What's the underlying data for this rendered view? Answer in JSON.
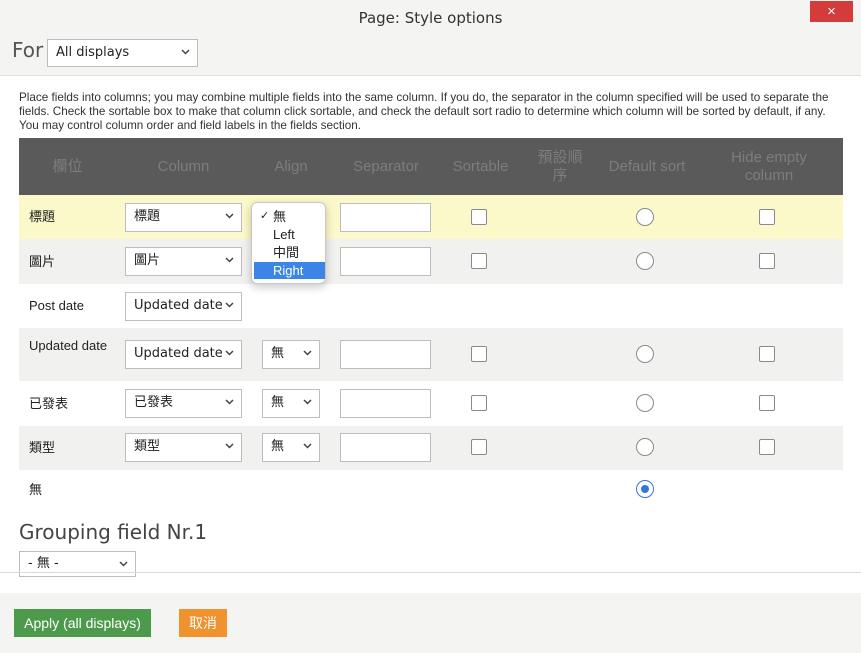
{
  "dialog": {
    "title": "Page: Style options",
    "close_icon": "×"
  },
  "for": {
    "label": "For",
    "selected": "All displays"
  },
  "description": "Place fields into columns; you may combine multiple fields into the same column. If you do, the separator in the column specified will be used to separate the fields. Check the sortable box to make that column click sortable, and check the default sort radio to determine which column will be sorted by default, if any. You may control column order and field labels in the fields section.",
  "table": {
    "headers": [
      "欄位",
      "Column",
      "Align",
      "Separator",
      "Sortable",
      "預設順序",
      "Default sort",
      "Hide empty column"
    ],
    "rows": [
      {
        "field": "標題",
        "column": "標題",
        "align": "無",
        "default_sort": false
      },
      {
        "field": "圖片",
        "column": "圖片",
        "align": "無",
        "default_sort": false
      },
      {
        "field": "Post date",
        "column": "Updated date"
      },
      {
        "field": "Updated date",
        "column": "Updated date",
        "align": "無",
        "default_sort": false
      },
      {
        "field": "已發表",
        "column": "已發表",
        "align": "無",
        "default_sort": false
      },
      {
        "field": "類型",
        "column": "類型",
        "align": "無",
        "default_sort": false
      },
      {
        "field": "無",
        "default_sort": true
      }
    ]
  },
  "align_dropdown": {
    "options": [
      "無",
      "Left",
      "中間",
      "Right"
    ],
    "checked": "無",
    "highlighted": "Right"
  },
  "grouping": {
    "title": "Grouping field Nr.1",
    "selected": "- 無 -"
  },
  "footer": {
    "apply_label": "Apply (all displays)",
    "cancel_label": "取消"
  },
  "colors": {
    "apply": "#4d9a4c",
    "cancel": "#f0922e",
    "close": "#d43b3b",
    "highlight_row": "#fbf8c9",
    "header": "#5a5a5a"
  }
}
